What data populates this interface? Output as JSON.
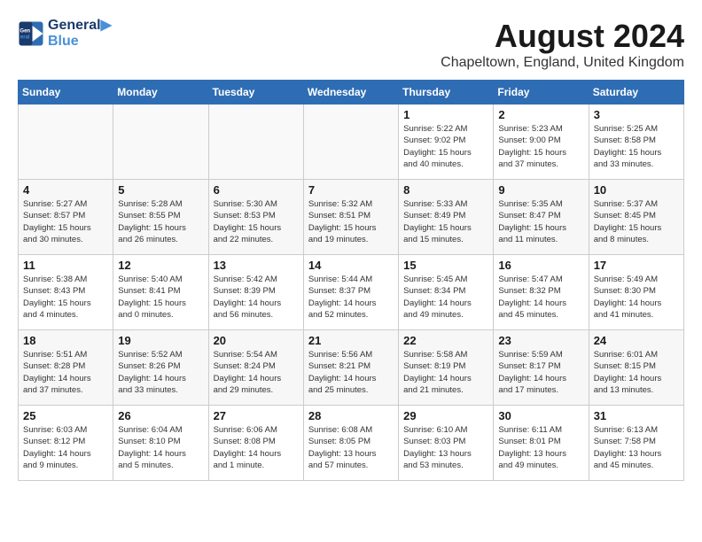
{
  "header": {
    "logo_line1": "General",
    "logo_line2": "Blue",
    "month_year": "August 2024",
    "location": "Chapeltown, England, United Kingdom"
  },
  "weekdays": [
    "Sunday",
    "Monday",
    "Tuesday",
    "Wednesday",
    "Thursday",
    "Friday",
    "Saturday"
  ],
  "weeks": [
    [
      {
        "day": "",
        "info": ""
      },
      {
        "day": "",
        "info": ""
      },
      {
        "day": "",
        "info": ""
      },
      {
        "day": "",
        "info": ""
      },
      {
        "day": "1",
        "info": "Sunrise: 5:22 AM\nSunset: 9:02 PM\nDaylight: 15 hours\nand 40 minutes."
      },
      {
        "day": "2",
        "info": "Sunrise: 5:23 AM\nSunset: 9:00 PM\nDaylight: 15 hours\nand 37 minutes."
      },
      {
        "day": "3",
        "info": "Sunrise: 5:25 AM\nSunset: 8:58 PM\nDaylight: 15 hours\nand 33 minutes."
      }
    ],
    [
      {
        "day": "4",
        "info": "Sunrise: 5:27 AM\nSunset: 8:57 PM\nDaylight: 15 hours\nand 30 minutes."
      },
      {
        "day": "5",
        "info": "Sunrise: 5:28 AM\nSunset: 8:55 PM\nDaylight: 15 hours\nand 26 minutes."
      },
      {
        "day": "6",
        "info": "Sunrise: 5:30 AM\nSunset: 8:53 PM\nDaylight: 15 hours\nand 22 minutes."
      },
      {
        "day": "7",
        "info": "Sunrise: 5:32 AM\nSunset: 8:51 PM\nDaylight: 15 hours\nand 19 minutes."
      },
      {
        "day": "8",
        "info": "Sunrise: 5:33 AM\nSunset: 8:49 PM\nDaylight: 15 hours\nand 15 minutes."
      },
      {
        "day": "9",
        "info": "Sunrise: 5:35 AM\nSunset: 8:47 PM\nDaylight: 15 hours\nand 11 minutes."
      },
      {
        "day": "10",
        "info": "Sunrise: 5:37 AM\nSunset: 8:45 PM\nDaylight: 15 hours\nand 8 minutes."
      }
    ],
    [
      {
        "day": "11",
        "info": "Sunrise: 5:38 AM\nSunset: 8:43 PM\nDaylight: 15 hours\nand 4 minutes."
      },
      {
        "day": "12",
        "info": "Sunrise: 5:40 AM\nSunset: 8:41 PM\nDaylight: 15 hours\nand 0 minutes."
      },
      {
        "day": "13",
        "info": "Sunrise: 5:42 AM\nSunset: 8:39 PM\nDaylight: 14 hours\nand 56 minutes."
      },
      {
        "day": "14",
        "info": "Sunrise: 5:44 AM\nSunset: 8:37 PM\nDaylight: 14 hours\nand 52 minutes."
      },
      {
        "day": "15",
        "info": "Sunrise: 5:45 AM\nSunset: 8:34 PM\nDaylight: 14 hours\nand 49 minutes."
      },
      {
        "day": "16",
        "info": "Sunrise: 5:47 AM\nSunset: 8:32 PM\nDaylight: 14 hours\nand 45 minutes."
      },
      {
        "day": "17",
        "info": "Sunrise: 5:49 AM\nSunset: 8:30 PM\nDaylight: 14 hours\nand 41 minutes."
      }
    ],
    [
      {
        "day": "18",
        "info": "Sunrise: 5:51 AM\nSunset: 8:28 PM\nDaylight: 14 hours\nand 37 minutes."
      },
      {
        "day": "19",
        "info": "Sunrise: 5:52 AM\nSunset: 8:26 PM\nDaylight: 14 hours\nand 33 minutes."
      },
      {
        "day": "20",
        "info": "Sunrise: 5:54 AM\nSunset: 8:24 PM\nDaylight: 14 hours\nand 29 minutes."
      },
      {
        "day": "21",
        "info": "Sunrise: 5:56 AM\nSunset: 8:21 PM\nDaylight: 14 hours\nand 25 minutes."
      },
      {
        "day": "22",
        "info": "Sunrise: 5:58 AM\nSunset: 8:19 PM\nDaylight: 14 hours\nand 21 minutes."
      },
      {
        "day": "23",
        "info": "Sunrise: 5:59 AM\nSunset: 8:17 PM\nDaylight: 14 hours\nand 17 minutes."
      },
      {
        "day": "24",
        "info": "Sunrise: 6:01 AM\nSunset: 8:15 PM\nDaylight: 14 hours\nand 13 minutes."
      }
    ],
    [
      {
        "day": "25",
        "info": "Sunrise: 6:03 AM\nSunset: 8:12 PM\nDaylight: 14 hours\nand 9 minutes."
      },
      {
        "day": "26",
        "info": "Sunrise: 6:04 AM\nSunset: 8:10 PM\nDaylight: 14 hours\nand 5 minutes."
      },
      {
        "day": "27",
        "info": "Sunrise: 6:06 AM\nSunset: 8:08 PM\nDaylight: 14 hours\nand 1 minute."
      },
      {
        "day": "28",
        "info": "Sunrise: 6:08 AM\nSunset: 8:05 PM\nDaylight: 13 hours\nand 57 minutes."
      },
      {
        "day": "29",
        "info": "Sunrise: 6:10 AM\nSunset: 8:03 PM\nDaylight: 13 hours\nand 53 minutes."
      },
      {
        "day": "30",
        "info": "Sunrise: 6:11 AM\nSunset: 8:01 PM\nDaylight: 13 hours\nand 49 minutes."
      },
      {
        "day": "31",
        "info": "Sunrise: 6:13 AM\nSunset: 7:58 PM\nDaylight: 13 hours\nand 45 minutes."
      }
    ]
  ]
}
